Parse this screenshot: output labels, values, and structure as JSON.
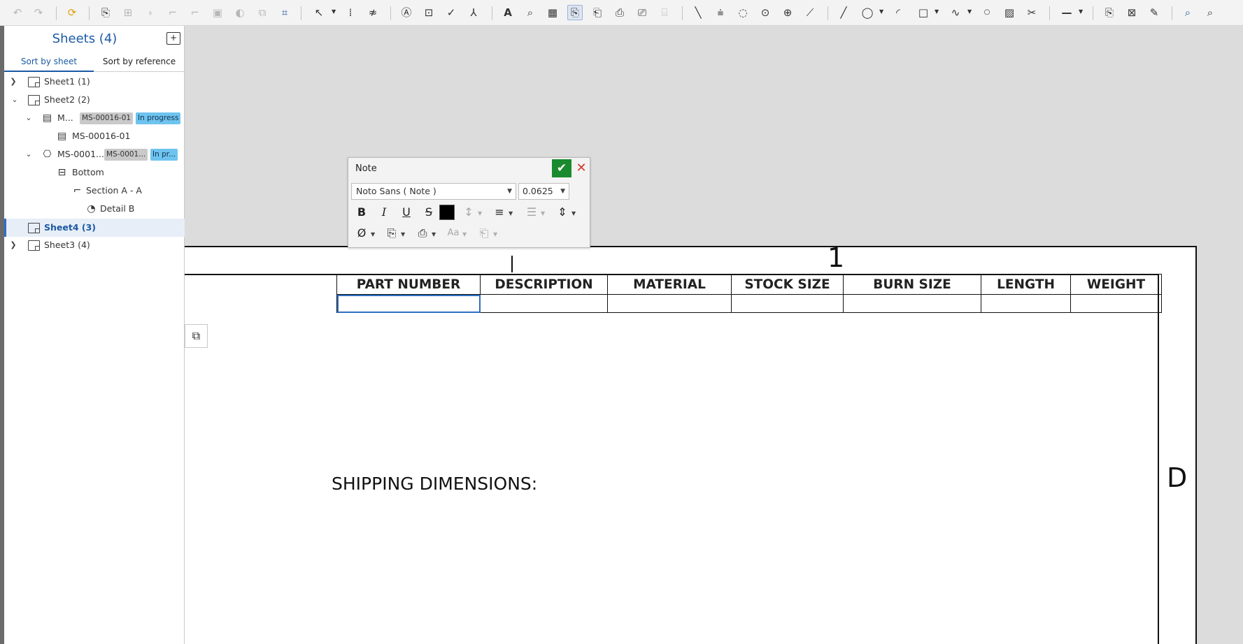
{
  "toolbar": {
    "icons": [
      "undo-icon",
      "redo-icon",
      "update-icon",
      "insert-view-icon",
      "projected-view-icon",
      "auxiliary-view-icon",
      "section-view-icon",
      "detail-view-icon",
      "broken-view-icon",
      "crop-view-icon",
      "break-view-icon",
      "alternate-view-icon",
      "crop-icon",
      "dimension-icon",
      "ordinate-icon",
      "angle-icon",
      "note-icon",
      "datum-icon",
      "check-icon",
      "balloon-icon",
      "text-icon",
      "search-icon",
      "table-icon",
      "bom-table-icon",
      "hole-table-icon",
      "revision-table-icon",
      "inspection-table-icon",
      "general-table-icon",
      "line-icon",
      "centerline-icon",
      "circle-centerline-icon",
      "point-icon",
      "center-mark-icon",
      "construction-line-icon",
      "sketch-line-icon",
      "circle-icon",
      "arc-icon",
      "rectangle-icon",
      "spline-icon",
      "sketch-point-icon",
      "hatch-icon",
      "trim-icon",
      "line-style-icon",
      "export-dxf-icon",
      "insert-image-icon",
      "pen-icon",
      "check-drawing-icon",
      "search-zoom-icon"
    ]
  },
  "panel": {
    "title": "Sheets (4)",
    "tabs": [
      "Sort by sheet",
      "Sort by reference"
    ],
    "tree": [
      {
        "label": "Sheet1 (1)",
        "expanded": false
      },
      {
        "label": "Sheet2 (2)",
        "expanded": true
      },
      {
        "label": "M...",
        "badge1": "MS-00016-01",
        "badge2": "In progress"
      },
      {
        "label": "MS-00016-01"
      },
      {
        "label": "MS-0001...",
        "badge1": "MS-0001...",
        "badge2": "In pr..."
      },
      {
        "label": "Bottom"
      },
      {
        "label": "Section A - A"
      },
      {
        "label": "Detail B"
      },
      {
        "label": "Sheet4 (3)",
        "selected": true
      },
      {
        "label": "Sheet3 (4)",
        "expanded": false
      }
    ]
  },
  "note_dialog": {
    "title": "Note",
    "font": "Noto Sans ( Note )",
    "size": "0.0625",
    "text_color": "#000000"
  },
  "drawing": {
    "zone_number": "1",
    "zone_letter": "D",
    "table_headers": [
      "PART NUMBER",
      "DESCRIPTION",
      "MATERIAL",
      "STOCK SIZE",
      "BURN SIZE",
      "LENGTH",
      "WEIGHT"
    ],
    "shipping_label": "SHIPPING DIMENSIONS:"
  },
  "colors": {
    "accent": "#1b5aa5",
    "ok": "#1a8a2e",
    "cancel": "#d23a2a",
    "badge_status": "#6ec3ef"
  }
}
